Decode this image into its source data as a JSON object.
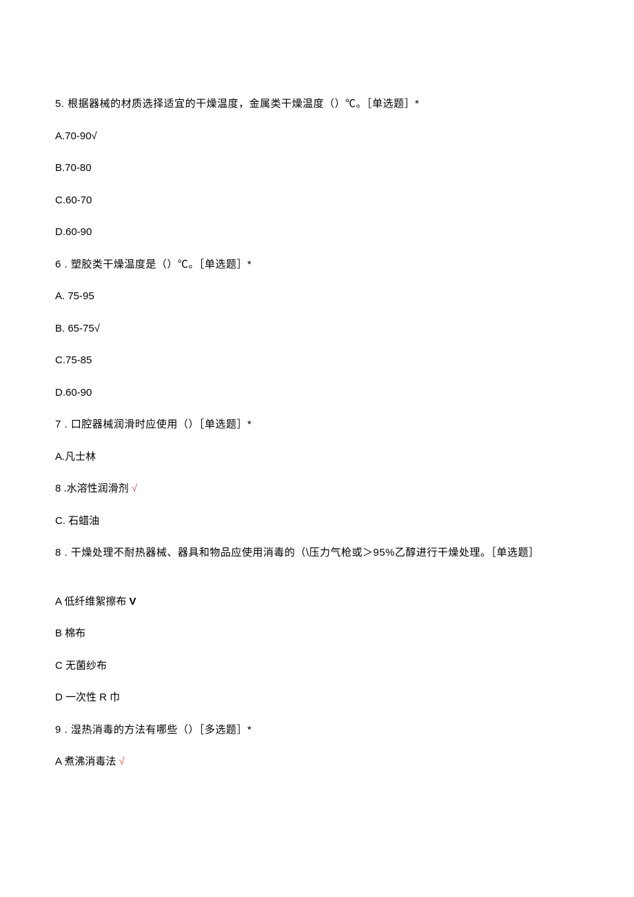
{
  "q5": {
    "text": "5. 根据器械的材质选择适宜的干燥温度，金属类干燥温度（）℃。［单选题］*",
    "a": "A.70-90√",
    "b": "B.70-80",
    "c": "C.60-70",
    "d": "D.60-90"
  },
  "q6": {
    "text": "6   . 塑胶类干燥温度是（）℃。［单选题］*",
    "a": "A.   75-95",
    "b": "B.  65-75√",
    "c": "C.75-85",
    "d": "D.60-90"
  },
  "q7": {
    "text": "7   . 口腔器械润滑时应使用（）［单选题］*",
    "a": "A.凡士林",
    "b_prefix": "8   .水溶性润滑剂 ",
    "b_check": "√",
    "c": "C. 石蜡油"
  },
  "q8": {
    "text": "8   . 干燥处理不耐热器械、器具和物品应使用消毒的（\\压力气枪或＞95%乙醇进行干燥处理。［单选题］",
    "a_prefix": "A 低纤维絮擦布 ",
    "a_check": "V",
    "b": "B 棉布",
    "c": "C 无菌纱布",
    "d": "D 一次性 R 巾"
  },
  "q9": {
    "text": "9   . 湿热消毒的方法有哪些（）［多选题］*",
    "a_prefix": "A 煮沸消毒法 ",
    "a_check": "√"
  }
}
